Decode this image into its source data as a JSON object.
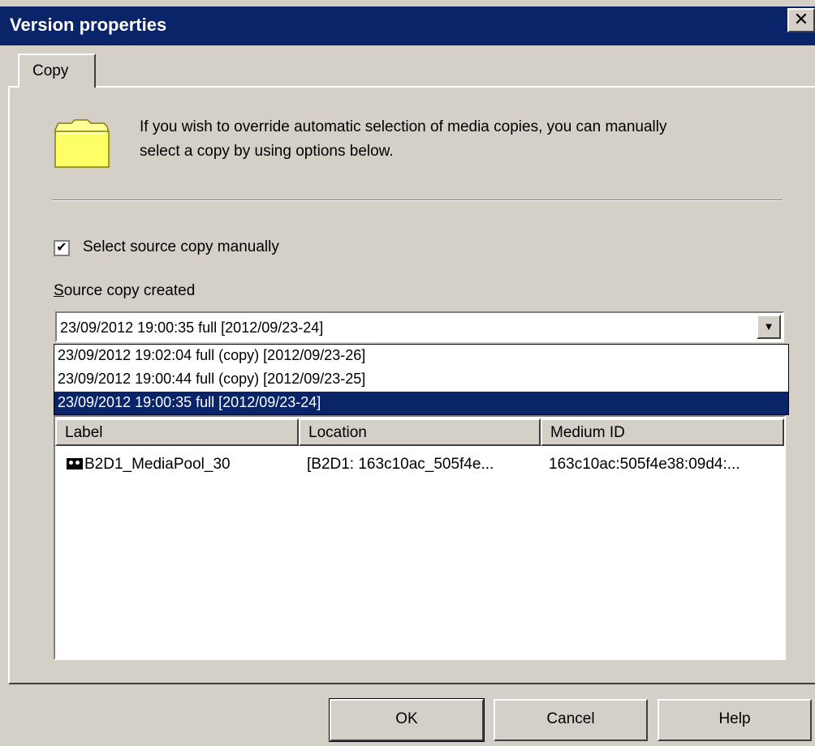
{
  "window": {
    "title": "Version properties",
    "close_glyph": "✕"
  },
  "tab": {
    "label": "Copy"
  },
  "info": {
    "line1": "If you wish to override automatic selection of media copies, you can manually",
    "line2": "select a copy by using options below.",
    "icon": "folder-icon"
  },
  "checkbox": {
    "label": "Select source copy manually",
    "checked": true,
    "mark": "✔"
  },
  "source": {
    "label_first": "S",
    "label_rest": "ource copy created"
  },
  "combo": {
    "value": "23/09/2012 19:00:35 full [2012/09/23-24]",
    "arrow": "▼",
    "options": [
      "23/09/2012 19:02:04 full (copy) [2012/09/23-26]",
      "23/09/2012 19:00:44 full (copy) [2012/09/23-25]",
      "23/09/2012 19:00:35 full [2012/09/23-24]"
    ],
    "selected_index": 2
  },
  "table": {
    "columns": [
      "Label",
      "Location",
      "Medium ID"
    ],
    "rows": [
      {
        "label": "B2D1_MediaPool_30",
        "location": "[B2D1: 163c10ac_505f4e...",
        "medium_id": "163c10ac:505f4e38:09d4:..."
      }
    ]
  },
  "buttons": {
    "ok": "OK",
    "cancel": "Cancel",
    "help": "Help"
  },
  "colors": {
    "titlebar": "#0a246a",
    "face": "#d4d0c8",
    "selection": "#0a246a"
  }
}
